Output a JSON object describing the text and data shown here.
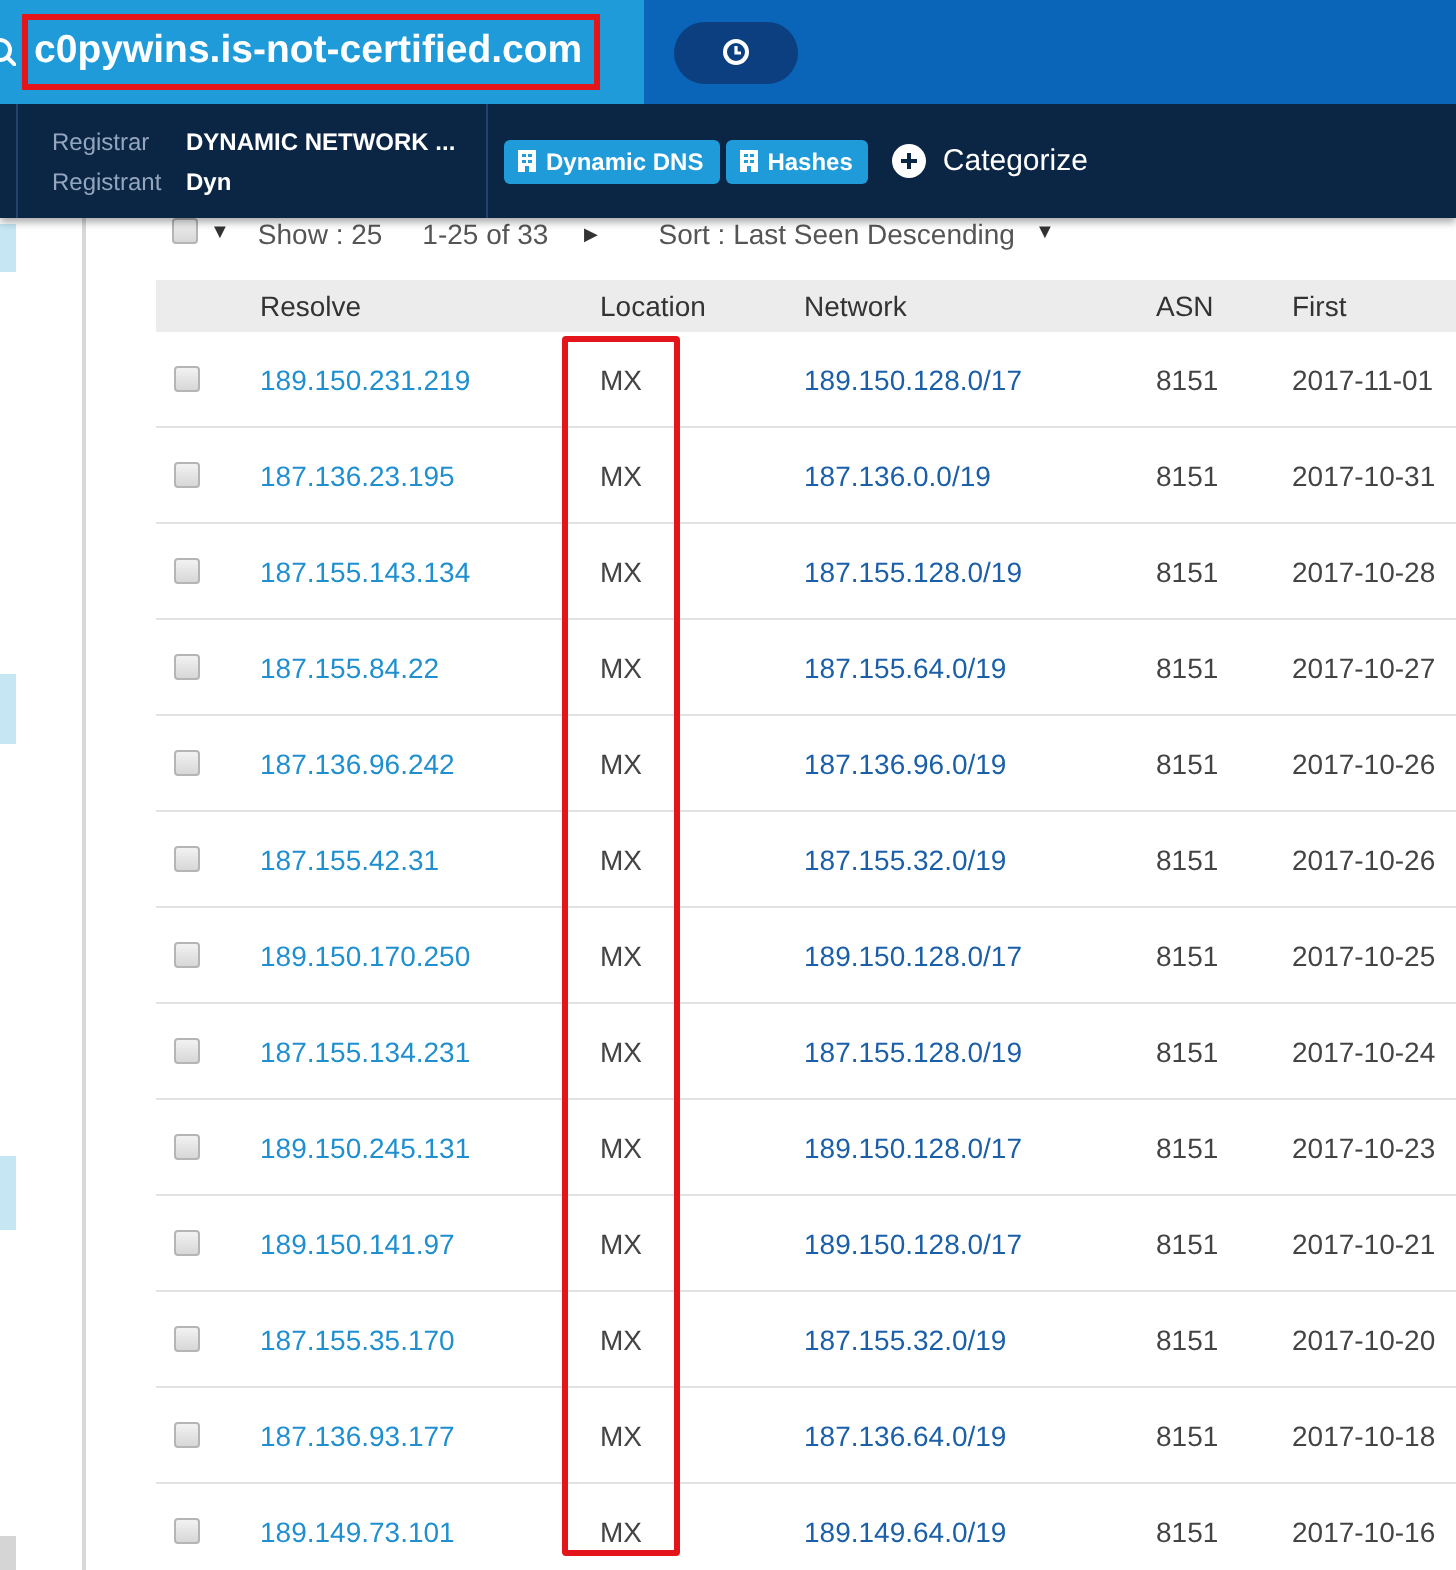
{
  "search": {
    "query": "c0pywins.is-not-certified.com",
    "highlighted": true
  },
  "details": [
    {
      "label": "Registrar",
      "value": "DYNAMIC NETWORK ..."
    },
    {
      "label": "Registrant",
      "value": "Dyn"
    }
  ],
  "tags": [
    "Dynamic DNS",
    "Hashes"
  ],
  "categorize": "Categorize",
  "toolbar": {
    "select_all_checked": false,
    "caret": "▼",
    "show": "Show : 25",
    "range": "1-25 of 33",
    "next": "▶",
    "sort": "Sort : Last Seen Descending",
    "sort_caret": "▼"
  },
  "table": {
    "columns": [
      {
        "label": "Resolve",
        "highlighted": false
      },
      {
        "label": "Location",
        "highlighted": true
      },
      {
        "label": "Network",
        "highlighted": false
      },
      {
        "label": "ASN",
        "highlighted": false
      },
      {
        "label": "First",
        "highlighted": false
      }
    ],
    "rows": [
      {
        "selected": false,
        "cells": [
          "189.150.231.219",
          "MX",
          "189.150.128.0/17",
          "8151",
          "2017-11-01"
        ]
      },
      {
        "selected": false,
        "cells": [
          "187.136.23.195",
          "MX",
          "187.136.0.0/19",
          "8151",
          "2017-10-31"
        ]
      },
      {
        "selected": false,
        "cells": [
          "187.155.143.134",
          "MX",
          "187.155.128.0/19",
          "8151",
          "2017-10-28"
        ]
      },
      {
        "selected": false,
        "cells": [
          "187.155.84.22",
          "MX",
          "187.155.64.0/19",
          "8151",
          "2017-10-27"
        ]
      },
      {
        "selected": false,
        "cells": [
          "187.136.96.242",
          "MX",
          "187.136.96.0/19",
          "8151",
          "2017-10-26"
        ]
      },
      {
        "selected": false,
        "cells": [
          "187.155.42.31",
          "MX",
          "187.155.32.0/19",
          "8151",
          "2017-10-26"
        ]
      },
      {
        "selected": false,
        "cells": [
          "189.150.170.250",
          "MX",
          "189.150.128.0/17",
          "8151",
          "2017-10-25"
        ]
      },
      {
        "selected": false,
        "cells": [
          "187.155.134.231",
          "MX",
          "187.155.128.0/19",
          "8151",
          "2017-10-24"
        ]
      },
      {
        "selected": false,
        "cells": [
          "189.150.245.131",
          "MX",
          "189.150.128.0/17",
          "8151",
          "2017-10-23"
        ]
      },
      {
        "selected": false,
        "cells": [
          "189.150.141.97",
          "MX",
          "189.150.128.0/17",
          "8151",
          "2017-10-21"
        ]
      },
      {
        "selected": false,
        "cells": [
          "187.155.35.170",
          "MX",
          "187.155.32.0/19",
          "8151",
          "2017-10-20"
        ]
      },
      {
        "selected": false,
        "cells": [
          "187.136.93.177",
          "MX",
          "187.136.64.0/19",
          "8151",
          "2017-10-18"
        ]
      },
      {
        "selected": false,
        "cells": [
          "189.149.73.101",
          "MX",
          "189.149.64.0/19",
          "8151",
          "2017-10-16"
        ]
      }
    ]
  }
}
